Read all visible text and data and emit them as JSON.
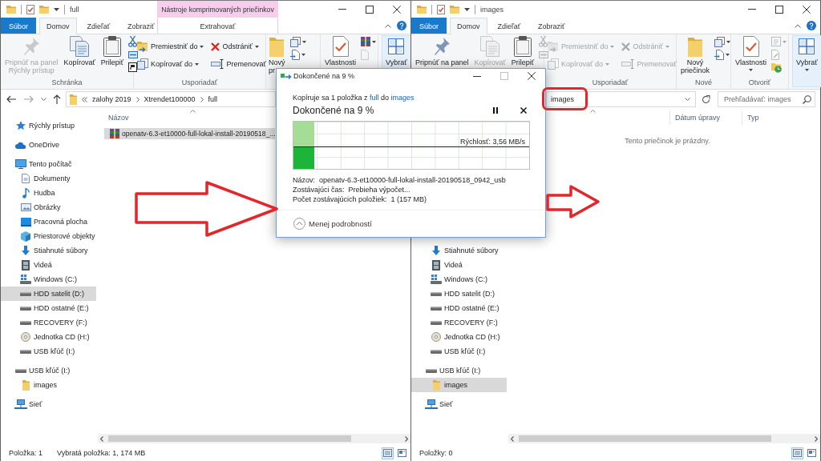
{
  "windows": [
    {
      "title": "full",
      "context_tab": {
        "group": "Nástroje komprimovaných priečinkov",
        "label": "Extrahovať",
        "selected": false
      },
      "window_buttons": [
        {
          "kind": "minimize",
          "disabled": false
        },
        {
          "kind": "maximize",
          "disabled": false
        },
        {
          "kind": "close",
          "disabled": false
        }
      ],
      "tabs": [
        {
          "label": "Súbor",
          "kind": "file",
          "selected": false
        },
        {
          "label": "Domov",
          "kind": "tab",
          "selected": true
        },
        {
          "label": "Zdieľať",
          "kind": "tab",
          "selected": false
        },
        {
          "label": "Zobraziť",
          "kind": "tab",
          "selected": false
        }
      ],
      "ribbon": {
        "groups": [
          {
            "label": "Schránka",
            "items": [
              {
                "kind": "large",
                "lines": [
                  "Pripnúť na panel",
                  "Rýchly prístup"
                ],
                "disabled": true
              },
              {
                "kind": "large",
                "lines": [
                  "Kopírovať"
                ],
                "disabled": false
              },
              {
                "kind": "large",
                "lines": [
                  "Prilepiť"
                ],
                "disabled": false
              },
              {
                "kind": "icon",
                "disabled": false
              },
              {
                "kind": "icon",
                "disabled": false
              },
              {
                "kind": "icon",
                "disabled": false
              }
            ]
          },
          {
            "label": "Usporiadať",
            "items": [
              {
                "kind": "small",
                "label": "Premiestniť do",
                "dropdown": true,
                "disabled": false
              },
              {
                "kind": "small",
                "label": "Kopírovať do",
                "dropdown": true,
                "disabled": false
              },
              {
                "kind": "small",
                "label": "Odstrániť",
                "dropdown": true,
                "disabled": false
              },
              {
                "kind": "small",
                "label": "Premenovať",
                "disabled": false
              }
            ]
          },
          {
            "items": [
              {
                "kind": "large",
                "lines": [
                  "Nový",
                  "pr"
                ],
                "disabled": false
              },
              {
                "kind": "icon",
                "dropdown": true,
                "disabled": false
              },
              {
                "kind": "icon",
                "dropdown": true,
                "disabled": false
              }
            ]
          },
          {
            "items": [
              {
                "kind": "large",
                "lines": [
                  "Vlastnosti"
                ],
                "disabled": false
              },
              {
                "kind": "icon",
                "dropdown": true,
                "disabled": false
              },
              {
                "kind": "icon",
                "disabled": true
              }
            ]
          },
          {
            "items": [
              {
                "kind": "collapsed",
                "lines": [
                  "Vybrať"
                ],
                "disabled": false
              }
            ]
          }
        ]
      },
      "address": {
        "nav": [
          {
            "kind": "back",
            "disabled": false
          },
          {
            "kind": "forward",
            "disabled": true
          },
          {
            "kind": "recent",
            "disabled": false
          },
          {
            "kind": "up",
            "disabled": false
          }
        ],
        "overflow": true,
        "path": [
          "zalohy 2019",
          "Xtrendet100000",
          "full"
        ]
      },
      "navigation": {
        "items": [
          {
            "label": "Rýchly prístup",
            "kind": "star",
            "selected": false
          },
          {
            "label": "OneDrive",
            "kind": "cloud",
            "selected": false
          },
          {
            "label": "Tento počítač",
            "kind": "computer",
            "selected": false,
            "children": [
              {
                "label": "Dokumenty",
                "kind": "documents",
                "selected": false
              },
              {
                "label": "Hudba",
                "kind": "music",
                "selected": false
              },
              {
                "label": "Obrázky",
                "kind": "pictures",
                "selected": false
              },
              {
                "label": "Pracovná plocha",
                "kind": "desktop",
                "selected": false
              },
              {
                "label": "Priestorové objekty",
                "kind": "objects",
                "selected": false
              },
              {
                "label": "Stiahnuté súbory",
                "kind": "downloads",
                "selected": false
              },
              {
                "label": "Videá",
                "kind": "videos",
                "selected": false
              },
              {
                "label": "Windows (C:)",
                "kind": "system-drive",
                "selected": false
              },
              {
                "label": "HDD satelit (D:)",
                "kind": "drive",
                "selected": true
              },
              {
                "label": "HDD ostatné (E:)",
                "kind": "drive",
                "selected": false
              },
              {
                "label": "RECOVERY (F:)",
                "kind": "drive",
                "selected": false
              },
              {
                "label": "Jednotka CD (H:)",
                "kind": "cd",
                "selected": false
              },
              {
                "label": "USB kľúč (I:)",
                "kind": "drive",
                "selected": false
              }
            ]
          },
          {
            "label": "USB kľúč (I:)",
            "kind": "drive",
            "selected": false,
            "children": [
              {
                "label": "images",
                "kind": "folder",
                "selected": false
              }
            ]
          },
          {
            "label": "Sieť",
            "kind": "network",
            "selected": false
          }
        ]
      },
      "files": {
        "columns": [
          {
            "label": "Názov",
            "sorted": true
          }
        ],
        "rows": [
          {
            "name": "openatv-6.3-et10000-full-lokal-install-20190518_...",
            "selected": true
          }
        ]
      },
      "status": {
        "texts": [
          "Položka: 1",
          "Vybratá položka: 1, 174 MB"
        ],
        "views": [
          {
            "kind": "details",
            "selected": true
          },
          {
            "kind": "tiles",
            "selected": false
          }
        ]
      }
    },
    {
      "title": "images",
      "window_buttons": [
        {
          "kind": "minimize",
          "disabled": false
        },
        {
          "kind": "maximize",
          "disabled": false
        },
        {
          "kind": "close",
          "disabled": false
        }
      ],
      "tabs": [
        {
          "label": "Súbor",
          "kind": "file",
          "selected": false
        },
        {
          "label": "Domov",
          "kind": "tab",
          "selected": true
        },
        {
          "label": "Zdieľať",
          "kind": "tab",
          "selected": false
        },
        {
          "label": "Zobraziť",
          "kind": "tab",
          "selected": false
        }
      ],
      "ribbon": {
        "groups": [
          {
            "items": [
              {
                "kind": "large",
                "lines": [
                  "Pripnúť na panel"
                ],
                "disabled": false
              },
              {
                "kind": "large",
                "lines": [
                  "Kopírovať"
                ],
                "disabled": true
              },
              {
                "kind": "large",
                "lines": [
                  "Prilepiť"
                ],
                "disabled": false
              },
              {
                "kind": "icon",
                "disabled": true
              },
              {
                "kind": "icon",
                "disabled": true
              }
            ]
          },
          {
            "label": "Usporiadať",
            "items": [
              {
                "kind": "small",
                "label": "Premiestniť do",
                "dropdown": true,
                "disabled": true
              },
              {
                "kind": "small",
                "label": "Kopírovať do",
                "dropdown": true,
                "disabled": true
              },
              {
                "kind": "small",
                "label": "Odstrániť",
                "dropdown": true,
                "disabled": true
              },
              {
                "kind": "small",
                "label": "Premenovať",
                "disabled": true
              }
            ]
          },
          {
            "label": "Nové",
            "items": [
              {
                "kind": "large",
                "lines": [
                  "Nový",
                  "priečinok"
                ],
                "disabled": false
              },
              {
                "kind": "icon",
                "dropdown": true,
                "disabled": false
              },
              {
                "kind": "icon",
                "dropdown": true,
                "disabled": false
              }
            ]
          },
          {
            "label": "Otvoriť",
            "items": [
              {
                "kind": "large",
                "lines": [
                  "Vlastnosti"
                ],
                "dropdown": true,
                "disabled": false
              },
              {
                "kind": "icon",
                "dropdown": true,
                "disabled": true
              },
              {
                "kind": "icon",
                "disabled": true
              },
              {
                "kind": "icon",
                "disabled": false
              }
            ]
          },
          {
            "items": [
              {
                "kind": "collapsed",
                "lines": [
                  "Vybrať"
                ],
                "dropdown": true,
                "disabled": false
              }
            ]
          }
        ]
      },
      "address": {
        "value": "images",
        "refresh": true,
        "search": {
          "placeholder": "Prehľadávať: images"
        }
      },
      "navigation": {
        "items": [
          {
            "children": [
              {
                "label": "Stiahnuté súbory",
                "kind": "downloads",
                "selected": false
              },
              {
                "label": "Videá",
                "kind": "videos",
                "selected": false
              },
              {
                "label": "Windows (C:)",
                "kind": "system-drive",
                "selected": false
              },
              {
                "label": "HDD satelit (D:)",
                "kind": "drive",
                "selected": false
              },
              {
                "label": "HDD ostatné (E:)",
                "kind": "drive",
                "selected": false
              },
              {
                "label": "RECOVERY (F:)",
                "kind": "drive",
                "selected": false
              },
              {
                "label": "Jednotka CD (H:)",
                "kind": "cd",
                "selected": false
              },
              {
                "label": "USB kľúč (I:)",
                "kind": "drive",
                "selected": false
              }
            ]
          },
          {
            "label": "USB kľúč (I:)",
            "kind": "drive",
            "selected": false,
            "children": [
              {
                "label": "images",
                "kind": "folder",
                "selected": true
              }
            ]
          },
          {
            "label": "Sieť",
            "kind": "network",
            "selected": false
          }
        ]
      },
      "files": {
        "columns": [
          {
            "sorted": true
          },
          {
            "label": "Dátum úpravy"
          },
          {
            "label": "Typ"
          }
        ],
        "empty": "Tento priečinok je prázdny."
      },
      "status": {
        "texts": [
          "Položky: 0"
        ],
        "views": [
          {
            "kind": "details",
            "selected": true
          },
          {
            "kind": "tiles",
            "selected": false
          }
        ]
      }
    }
  ],
  "copy_dialog": {
    "title": "Dokončené na 9 %",
    "window_buttons": [
      {
        "kind": "minimize",
        "disabled": false
      },
      {
        "kind": "maximize",
        "disabled": true
      },
      {
        "kind": "close",
        "disabled": false
      }
    ],
    "summary": {
      "text": "Kopíruje sa 1 položka z",
      "source": "full",
      "joiner": "do",
      "target": "images"
    },
    "heading": "Dokončené na 9 %",
    "progress": {
      "level": 0.09
    },
    "speed": "Rýchlosť: 3,56 MB/s",
    "details": [
      {
        "label": "Názov:",
        "value": "openatv-6.3-et10000-full-lokal-install-20190518_0942_usb"
      },
      {
        "label": "Zostávajúci čas:",
        "value": "Prebieha výpočet..."
      },
      {
        "label": "Počet zostávajúcich položiek:",
        "value": "1 (157 MB)"
      }
    ],
    "toggle": "Menej podrobností"
  },
  "annotations": [
    {
      "kind": "arrow"
    },
    {
      "kind": "arrow"
    },
    {
      "kind": "ring"
    }
  ]
}
